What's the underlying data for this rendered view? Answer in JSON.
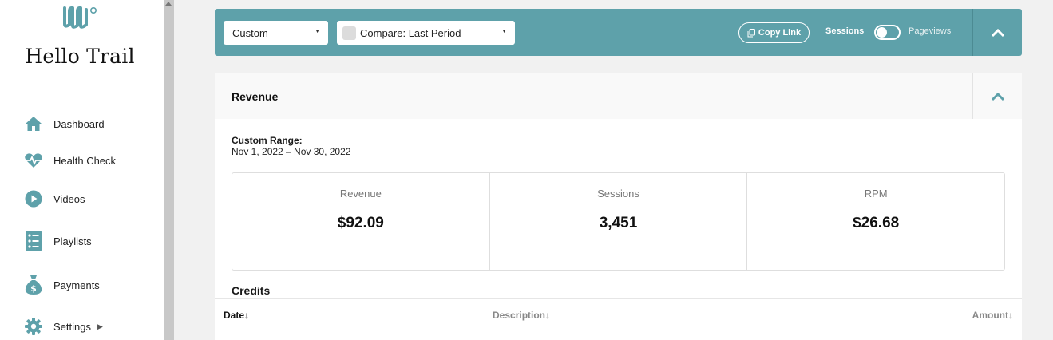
{
  "brand": {
    "name": "Hello Trail",
    "logo_icon": "mediavine-logo-icon"
  },
  "sidebar": {
    "items": [
      {
        "label": "Dashboard",
        "icon": "home-icon"
      },
      {
        "label": "Health Check",
        "icon": "heart-pulse-icon"
      },
      {
        "label": "Videos",
        "icon": "play-circle-icon"
      },
      {
        "label": "Playlists",
        "icon": "list-icon"
      },
      {
        "label": "Payments",
        "icon": "money-bag-icon"
      },
      {
        "label": "Settings",
        "icon": "gear-icon",
        "has_submenu": true
      }
    ]
  },
  "filters": {
    "range_select": "Custom",
    "compare_select": "Compare: Last Period",
    "copy_link": "Copy Link",
    "toggle_left": "Sessions",
    "toggle_right": "Pageviews"
  },
  "revenue": {
    "title": "Revenue",
    "range_label": "Custom Range:",
    "range_dates": "Nov 1, 2022 – Nov 30, 2022",
    "stats": [
      {
        "label": "Revenue",
        "value": "$92.09"
      },
      {
        "label": "Sessions",
        "value": "3,451"
      },
      {
        "label": "RPM",
        "value": "$26.68"
      }
    ]
  },
  "credits": {
    "title": "Credits",
    "columns": {
      "date": "Date↓",
      "description": "Description↓",
      "amount": "Amount↓"
    }
  },
  "colors": {
    "accent": "#5ea1aa",
    "background": "#f1f1f1"
  }
}
